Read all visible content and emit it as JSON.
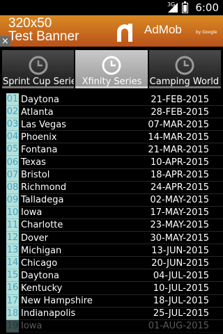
{
  "status_bar": {
    "network": "3G",
    "time": "6:00"
  },
  "ad": {
    "headline_line1": "320x50",
    "headline_line2": "Test Banner",
    "brand": "AdMob",
    "brand_suffix": "by Google",
    "close_glyph": "×"
  },
  "tabs": [
    {
      "label": "Sprint Cup Series",
      "icon": "clock-icon",
      "active": false
    },
    {
      "label": "Xfinity Series",
      "icon": "clock-icon",
      "active": true
    },
    {
      "label": "Camping World",
      "icon": "clock-icon",
      "active": false
    }
  ],
  "races": [
    {
      "num": "01",
      "name": "Daytona",
      "date": "21-FEB-2015"
    },
    {
      "num": "02",
      "name": "Atlanta",
      "date": "28-FEB-2015"
    },
    {
      "num": "03",
      "name": "Las Vegas",
      "date": "07-MAR-2015"
    },
    {
      "num": "04",
      "name": "Phoenix",
      "date": "14-MAR-2015"
    },
    {
      "num": "05",
      "name": "Fontana",
      "date": "21-MAR-2015"
    },
    {
      "num": "06",
      "name": "Texas",
      "date": "10-APR-2015"
    },
    {
      "num": "07",
      "name": "Bristol",
      "date": "18-APR-2015"
    },
    {
      "num": "08",
      "name": "Richmond",
      "date": "24-APR-2015"
    },
    {
      "num": "09",
      "name": "Talladega",
      "date": "02-MAY-2015"
    },
    {
      "num": "10",
      "name": "Iowa",
      "date": "17-MAY-2015"
    },
    {
      "num": "11",
      "name": "Charlotte",
      "date": "23-MAY-2015"
    },
    {
      "num": "12",
      "name": "Dover",
      "date": "30-MAY-2015"
    },
    {
      "num": "13",
      "name": "Michigan",
      "date": "13-JUN-2015"
    },
    {
      "num": "14",
      "name": "Chicago",
      "date": "20-JUN-2015"
    },
    {
      "num": "15",
      "name": "Daytona",
      "date": "04-JUL-2015"
    },
    {
      "num": "16",
      "name": "Kentucky",
      "date": "10-JUL-2015"
    },
    {
      "num": "17",
      "name": "New Hampshire",
      "date": "18-JUL-2015"
    },
    {
      "num": "18",
      "name": "Indianapolis",
      "date": "25-JUL-2015"
    },
    {
      "num": "19",
      "name": "Iowa",
      "date": "01-AUG-2015"
    }
  ]
}
